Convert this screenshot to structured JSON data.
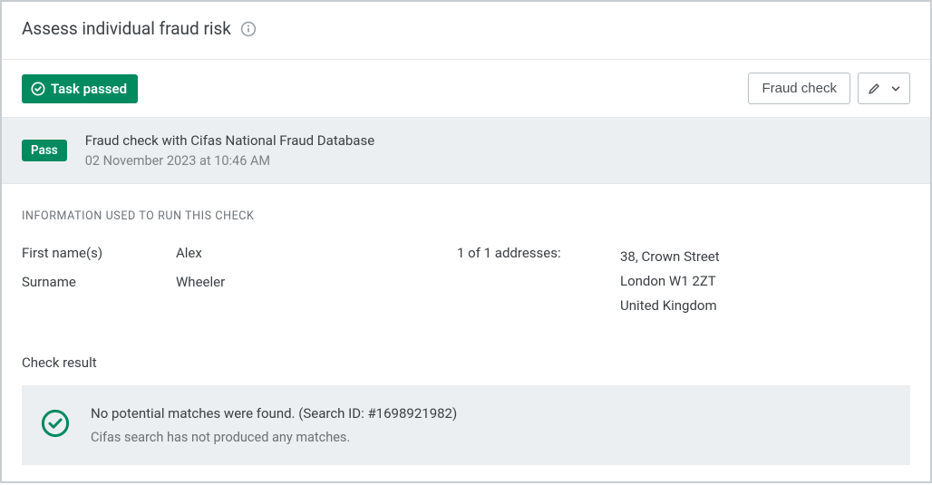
{
  "header": {
    "title": "Assess individual fraud risk"
  },
  "toolbar": {
    "task_passed_label": "Task passed",
    "fraud_check_label": "Fraud check"
  },
  "summary": {
    "pill": "Pass",
    "title": "Fraud check with Cifas National Fraud Database",
    "timestamp": "02 November 2023 at 10:46 AM"
  },
  "info": {
    "section_label": "INFORMATION USED TO RUN THIS CHECK",
    "first_names_label": "First name(s)",
    "first_names_value": "Alex",
    "surname_label": "Surname",
    "surname_value": "Wheeler",
    "addresses_label": "1 of 1 addresses:",
    "address_line1": "38, Crown Street",
    "address_line2": "London W1 2ZT",
    "address_line3": "United Kingdom"
  },
  "result": {
    "title": "Check result",
    "headline": "No potential matches were found. (Search ID: #1698921982)",
    "detail": "Cifas search has not produced any matches."
  }
}
